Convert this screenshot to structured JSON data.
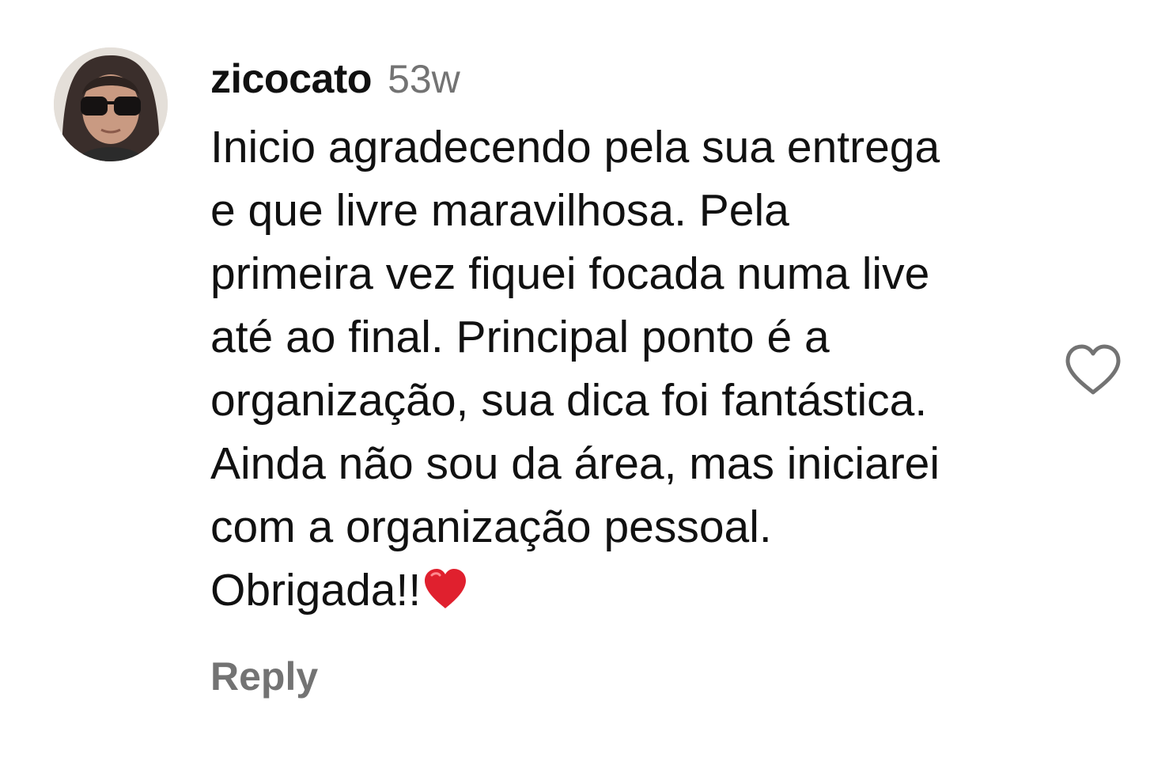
{
  "comment": {
    "username": "zicocato",
    "timestamp": "53w",
    "avatar_icon": "user-avatar-photo",
    "lines": [
      "Inicio agradecendo pela sua entrega",
      "e que livre maravilhosa. Pela",
      "primeira vez fiquei focada numa live",
      "até ao final. Principal ponto é a",
      "organização, sua dica foi fantástica.",
      "Ainda não sou da área, mas iniciarei",
      "com a organização pessoal."
    ],
    "last_line": "Obrigada!!",
    "last_line_emoji": "red-heart-emoji",
    "like_icon": "heart-outline-icon",
    "reply_label": "Reply"
  },
  "colors": {
    "text": "#111111",
    "secondary_text": "#737373",
    "emoji_heart": "#e0202e",
    "background": "#ffffff"
  }
}
